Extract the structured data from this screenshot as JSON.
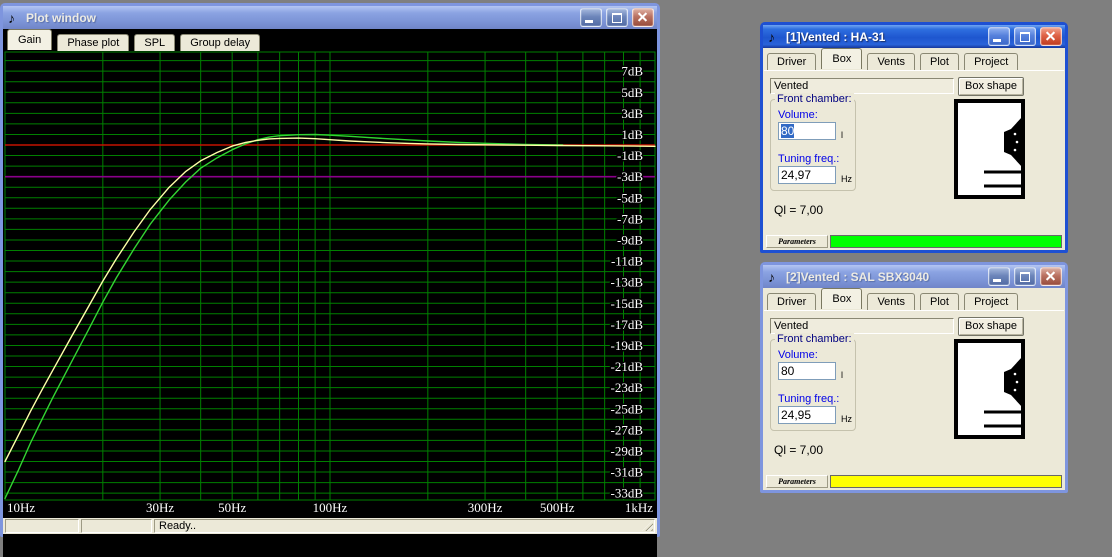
{
  "plot_window": {
    "icon": "♪",
    "title": "Plot window",
    "tabs": [
      "Gain",
      "Phase plot",
      "SPL",
      "Group delay"
    ],
    "active_tab": "Gain",
    "status": {
      "panel1": "",
      "panel2": "",
      "ready": "Ready.."
    }
  },
  "chart_data": {
    "type": "line",
    "title": "Gain",
    "x_scale": "log",
    "x_axis_unit": "Hz",
    "y_axis_unit": "dB",
    "x_range": [
      10,
      1000
    ],
    "y_range": [
      -34,
      9
    ],
    "grid": "on",
    "grid_color": "#008000",
    "background_color": "#000000",
    "x_gridlines": [
      10,
      20,
      30,
      40,
      50,
      60,
      70,
      80,
      90,
      100,
      200,
      300,
      400,
      500,
      600,
      700,
      800,
      900,
      1000
    ],
    "x_ticks": [
      {
        "value": 10,
        "label": "10Hz",
        "align": "start"
      },
      {
        "value": 30,
        "label": "30Hz",
        "align": "middle"
      },
      {
        "value": 50,
        "label": "50Hz",
        "align": "middle"
      },
      {
        "value": 100,
        "label": "100Hz",
        "align": "middle"
      },
      {
        "value": 300,
        "label": "300Hz",
        "align": "middle"
      },
      {
        "value": 500,
        "label": "500Hz",
        "align": "middle"
      },
      {
        "value": 1000,
        "label": "1kHz",
        "align": "end"
      }
    ],
    "y_ticks": [
      {
        "value": 7,
        "label": "7dB"
      },
      {
        "value": 5,
        "label": "5dB"
      },
      {
        "value": 3,
        "label": "3dB"
      },
      {
        "value": 1,
        "label": "1dB"
      },
      {
        "value": -1,
        "label": "-1dB"
      },
      {
        "value": -3,
        "label": "-3dB"
      },
      {
        "value": -5,
        "label": "-5dB"
      },
      {
        "value": -7,
        "label": "-7dB"
      },
      {
        "value": -9,
        "label": "-9dB"
      },
      {
        "value": -11,
        "label": "-11dB"
      },
      {
        "value": -13,
        "label": "-13dB"
      },
      {
        "value": -15,
        "label": "-15dB"
      },
      {
        "value": -17,
        "label": "-17dB"
      },
      {
        "value": -19,
        "label": "-19dB"
      },
      {
        "value": -21,
        "label": "-21dB"
      },
      {
        "value": -23,
        "label": "-23dB"
      },
      {
        "value": -25,
        "label": "-25dB"
      },
      {
        "value": -27,
        "label": "-27dB"
      },
      {
        "value": -29,
        "label": "-29dB"
      },
      {
        "value": -31,
        "label": "-31dB"
      },
      {
        "value": -33,
        "label": "-33dB"
      }
    ],
    "reference_lines": [
      {
        "value": 0,
        "color": "#C41200",
        "name": "0 dB reference"
      },
      {
        "value": -3,
        "color": "#8B008B",
        "name": "-3 dB reference"
      }
    ],
    "series": [
      {
        "name": "SAL SBX3040",
        "color": "#33D433",
        "points": [
          [
            10,
            -33.5
          ],
          [
            11,
            -30.8
          ],
          [
            12,
            -28.2
          ],
          [
            13,
            -26.0
          ],
          [
            14,
            -24.0
          ],
          [
            16,
            -20.6
          ],
          [
            18,
            -17.6
          ],
          [
            20,
            -14.9
          ],
          [
            22,
            -12.6
          ],
          [
            25,
            -9.8
          ],
          [
            28,
            -7.5
          ],
          [
            32,
            -5.2
          ],
          [
            36,
            -3.5
          ],
          [
            40,
            -2.2
          ],
          [
            45,
            -1.2
          ],
          [
            50,
            -0.45
          ],
          [
            55,
            0.1
          ],
          [
            60,
            0.5
          ],
          [
            65,
            0.75
          ],
          [
            70,
            0.88
          ],
          [
            80,
            0.98
          ],
          [
            90,
            1.0
          ],
          [
            100,
            0.93
          ],
          [
            115,
            0.82
          ],
          [
            130,
            0.72
          ],
          [
            150,
            0.6
          ],
          [
            175,
            0.48
          ],
          [
            200,
            0.38
          ],
          [
            250,
            0.25
          ],
          [
            300,
            0.16
          ],
          [
            350,
            0.1
          ],
          [
            400,
            0.06
          ],
          [
            450,
            0.03
          ],
          [
            520,
            0.0
          ]
        ]
      },
      {
        "name": "HA-31",
        "color": "#FFFFA8",
        "points": [
          [
            10,
            -30
          ],
          [
            11,
            -27.5
          ],
          [
            12,
            -25.2
          ],
          [
            13,
            -23.2
          ],
          [
            14,
            -21.4
          ],
          [
            16,
            -18.2
          ],
          [
            18,
            -15.4
          ],
          [
            20,
            -12.9
          ],
          [
            22,
            -10.8
          ],
          [
            25,
            -8.2
          ],
          [
            28,
            -6.1
          ],
          [
            32,
            -4.0
          ],
          [
            36,
            -2.5
          ],
          [
            40,
            -1.5
          ],
          [
            45,
            -0.7
          ],
          [
            50,
            -0.1
          ],
          [
            55,
            0.25
          ],
          [
            60,
            0.45
          ],
          [
            65,
            0.58
          ],
          [
            70,
            0.63
          ],
          [
            80,
            0.65
          ],
          [
            90,
            0.6
          ],
          [
            100,
            0.5
          ],
          [
            115,
            0.38
          ],
          [
            130,
            0.3
          ],
          [
            150,
            0.22
          ],
          [
            175,
            0.15
          ],
          [
            200,
            0.1
          ],
          [
            250,
            0.05
          ],
          [
            300,
            0.02
          ],
          [
            400,
            -0.02
          ],
          [
            500,
            -0.05
          ],
          [
            700,
            -0.08
          ],
          [
            1000,
            -0.12
          ]
        ]
      }
    ],
    "legend": "off"
  },
  "windows": [
    {
      "icon": "♪",
      "title": "[1]Vented : HA-31",
      "tabs": [
        "Driver",
        "Box",
        "Vents",
        "Plot",
        "Project"
      ],
      "active_tab": "Box",
      "box_type": "Vented",
      "box_shape_button": "Box shape",
      "front_chamber": {
        "legend": "Front chamber:",
        "volume_label": "Volume:",
        "volume_value": "80",
        "volume_unit": "l",
        "tuning_label": "Tuning freq.:",
        "tuning_value": "24,97",
        "tuning_unit": "Hz"
      },
      "ql_text": "Ql = 7,00",
      "parameters_label": "Parameters",
      "progress_color": "#00FF00",
      "progress_style": "background:#00FF00"
    },
    {
      "icon": "♪",
      "title": "[2]Vented : SAL SBX3040",
      "tabs": [
        "Driver",
        "Box",
        "Vents",
        "Plot",
        "Project"
      ],
      "active_tab": "Box",
      "box_type": "Vented",
      "box_shape_button": "Box shape",
      "front_chamber": {
        "legend": "Front chamber:",
        "volume_label": "Volume:",
        "volume_value": "80",
        "volume_unit": "l",
        "tuning_label": "Tuning freq.:",
        "tuning_value": "24,95",
        "tuning_unit": "Hz"
      },
      "ql_text": "Ql = 7,00",
      "parameters_label": "Parameters",
      "progress_color": "#FFFF00",
      "progress_style": "background:#FFFF00"
    }
  ]
}
